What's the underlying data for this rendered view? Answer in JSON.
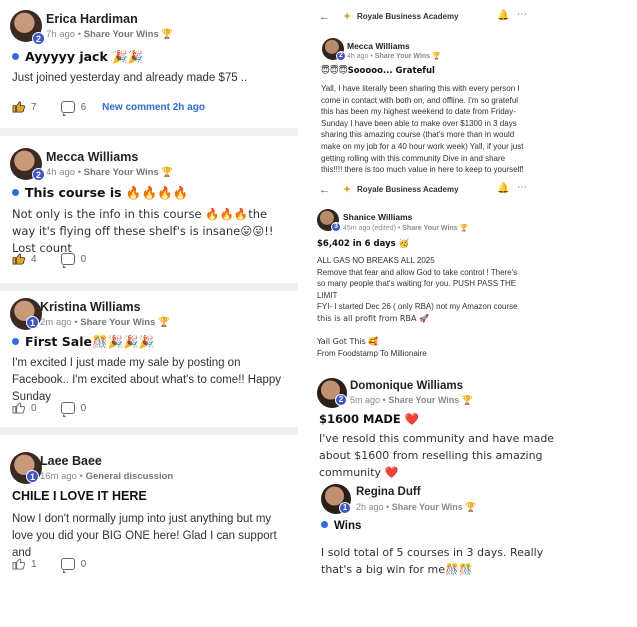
{
  "left_posts": [
    {
      "author": "Erica Hardiman",
      "level": "2",
      "time": "7h ago",
      "category": "Share Your Wins",
      "title": "Ayyyyy jack 🎉🎉",
      "body": "Just joined yesterday and already made $75 ..",
      "likes": "7",
      "comments": "6",
      "new_comment": "New comment 2h ago"
    },
    {
      "author": "Mecca Williams",
      "level": "2",
      "time": "4h ago",
      "category": "Share Your Wins",
      "title": "This course is 🔥🔥🔥🔥",
      "body": "Not only is the info in this course 🔥🔥🔥the way it's flying off these shelf's is insane😛😛!! Lost count",
      "likes": "4",
      "comments": "0"
    },
    {
      "author": "Kristina Williams",
      "level": "1",
      "time": "2m ago",
      "category": "Share Your Wins",
      "title": "First Sale🎊🎉🎉🎉",
      "body": "I'm excited I just made my sale by posting on Facebook.. I'm excited about what's to come!! Happy Sunday",
      "likes": "0",
      "comments": "0"
    },
    {
      "author": "Laee Baee",
      "level": "1",
      "time": "16m ago",
      "category": "General discussion",
      "title": "CHILE I LOVE IT HERE",
      "body": "Now I don't normally jump into just anything but my love you did your BIG ONE here! Glad I can support and",
      "likes": "1",
      "comments": "0"
    }
  ],
  "right_screens": [
    {
      "app_title": "Royale Business Academy",
      "author": "Mecca Williams",
      "level": "2",
      "time": "4h ago",
      "category": "Share Your Wins",
      "title": "😇😇😇Sooooo... Grateful",
      "body_lines": [
        "Yall, I have literally been sharing this with every person I",
        "come in contact with both on, and offline. I'm so grateful",
        "this has been my highest weekend to date from Friday-",
        "Sunday I have been able to make over $1300 in 3 days",
        "sharing this amazing course (that's more than in would",
        "make on my job for a 40 hour work week) Yall, if your just",
        "getting rolling with this community Dive in and share",
        "this!!!! there is too much value in here to keep to yourself!"
      ]
    },
    {
      "app_title": "Royale Business Academy",
      "author": "Shanice Williams",
      "level": "3",
      "time": "45m ago (edited)",
      "category": "Share Your Wins",
      "title": "$6,402 in 6 days 🥳",
      "body_lines": [
        "ALL GAS NO BREAKS ALL 2025",
        "Remove that fear and allow God to take control ! There's",
        "so many people that's waiting for you. PUSH PASS THE",
        "LIMIT",
        "FYI- I started Dec 26 ( only RBA) not my Amazon course",
        "this is all profit from RBA 🚀",
        "",
        "Yall Got This 🥰",
        "From Foodstamp To Millionaire"
      ]
    }
  ],
  "right_posts": [
    {
      "author": "Domonique Williams",
      "level": "2",
      "time": "5m ago",
      "category": "Share Your Wins",
      "title": "$1600 MADE ❤️",
      "body": "I've resold this community and have made about $1600 from reselling this amazing community ❤️"
    },
    {
      "author": "Regina Duff",
      "level": "1",
      "time": "2h ago",
      "category": "Share Your Wins",
      "title": "Wins",
      "body": "I sold total of 5 courses in 3 days. Really that's a big win for me🎊🎊"
    }
  ],
  "icons": {
    "trophy": "🏆",
    "back": "←",
    "bell": "🔔",
    "more": "⋯"
  },
  "colors": {
    "accent_blue": "#2f6be6",
    "level_badge": "#3d56c7",
    "separator": "#eef0f3"
  }
}
